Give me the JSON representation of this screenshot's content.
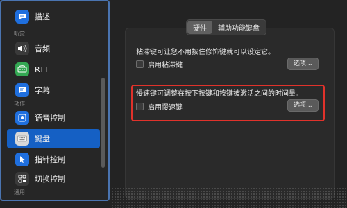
{
  "sidebar": {
    "items_top": [
      {
        "label": "描述",
        "icon": "speech-bubble-icon",
        "color": "#1f6fde"
      }
    ],
    "section_hearing": "听觉",
    "items_hearing": [
      {
        "label": "音频",
        "icon": "speaker-icon",
        "color": "#3a3a3a"
      },
      {
        "label": "RTT",
        "icon": "rtt-phone-icon",
        "color": "#34a853"
      },
      {
        "label": "字幕",
        "icon": "captions-icon",
        "color": "#1f6fde"
      }
    ],
    "section_motor": "动作",
    "items_motor": [
      {
        "label": "语音控制",
        "icon": "voice-control-icon",
        "color": "#1f6fde"
      },
      {
        "label": "键盘",
        "icon": "keyboard-icon",
        "color": "#d8d8d8",
        "selected": true
      },
      {
        "label": "指针控制",
        "icon": "pointer-control-icon",
        "color": "#1f6fde"
      },
      {
        "label": "切换控制",
        "icon": "switch-control-icon",
        "color": "#3a3a3a"
      }
    ],
    "section_general": "通用"
  },
  "tabs": [
    {
      "label": "硬件",
      "active": true
    },
    {
      "label": "辅助功能键盘",
      "active": false
    }
  ],
  "sticky_keys": {
    "description": "粘滞键可让您不用按住修饰键就可以设定它。",
    "checkbox_label": "启用粘滞键",
    "checked": false,
    "options_label": "选项..."
  },
  "slow_keys": {
    "description": "慢速键可调整在按下按键和按键被激活之间的时间量。",
    "checkbox_label": "启用慢速键",
    "checked": false,
    "options_label": "选项..."
  },
  "colors": {
    "selection": "#1560c4",
    "highlight_border": "#e0322b"
  }
}
